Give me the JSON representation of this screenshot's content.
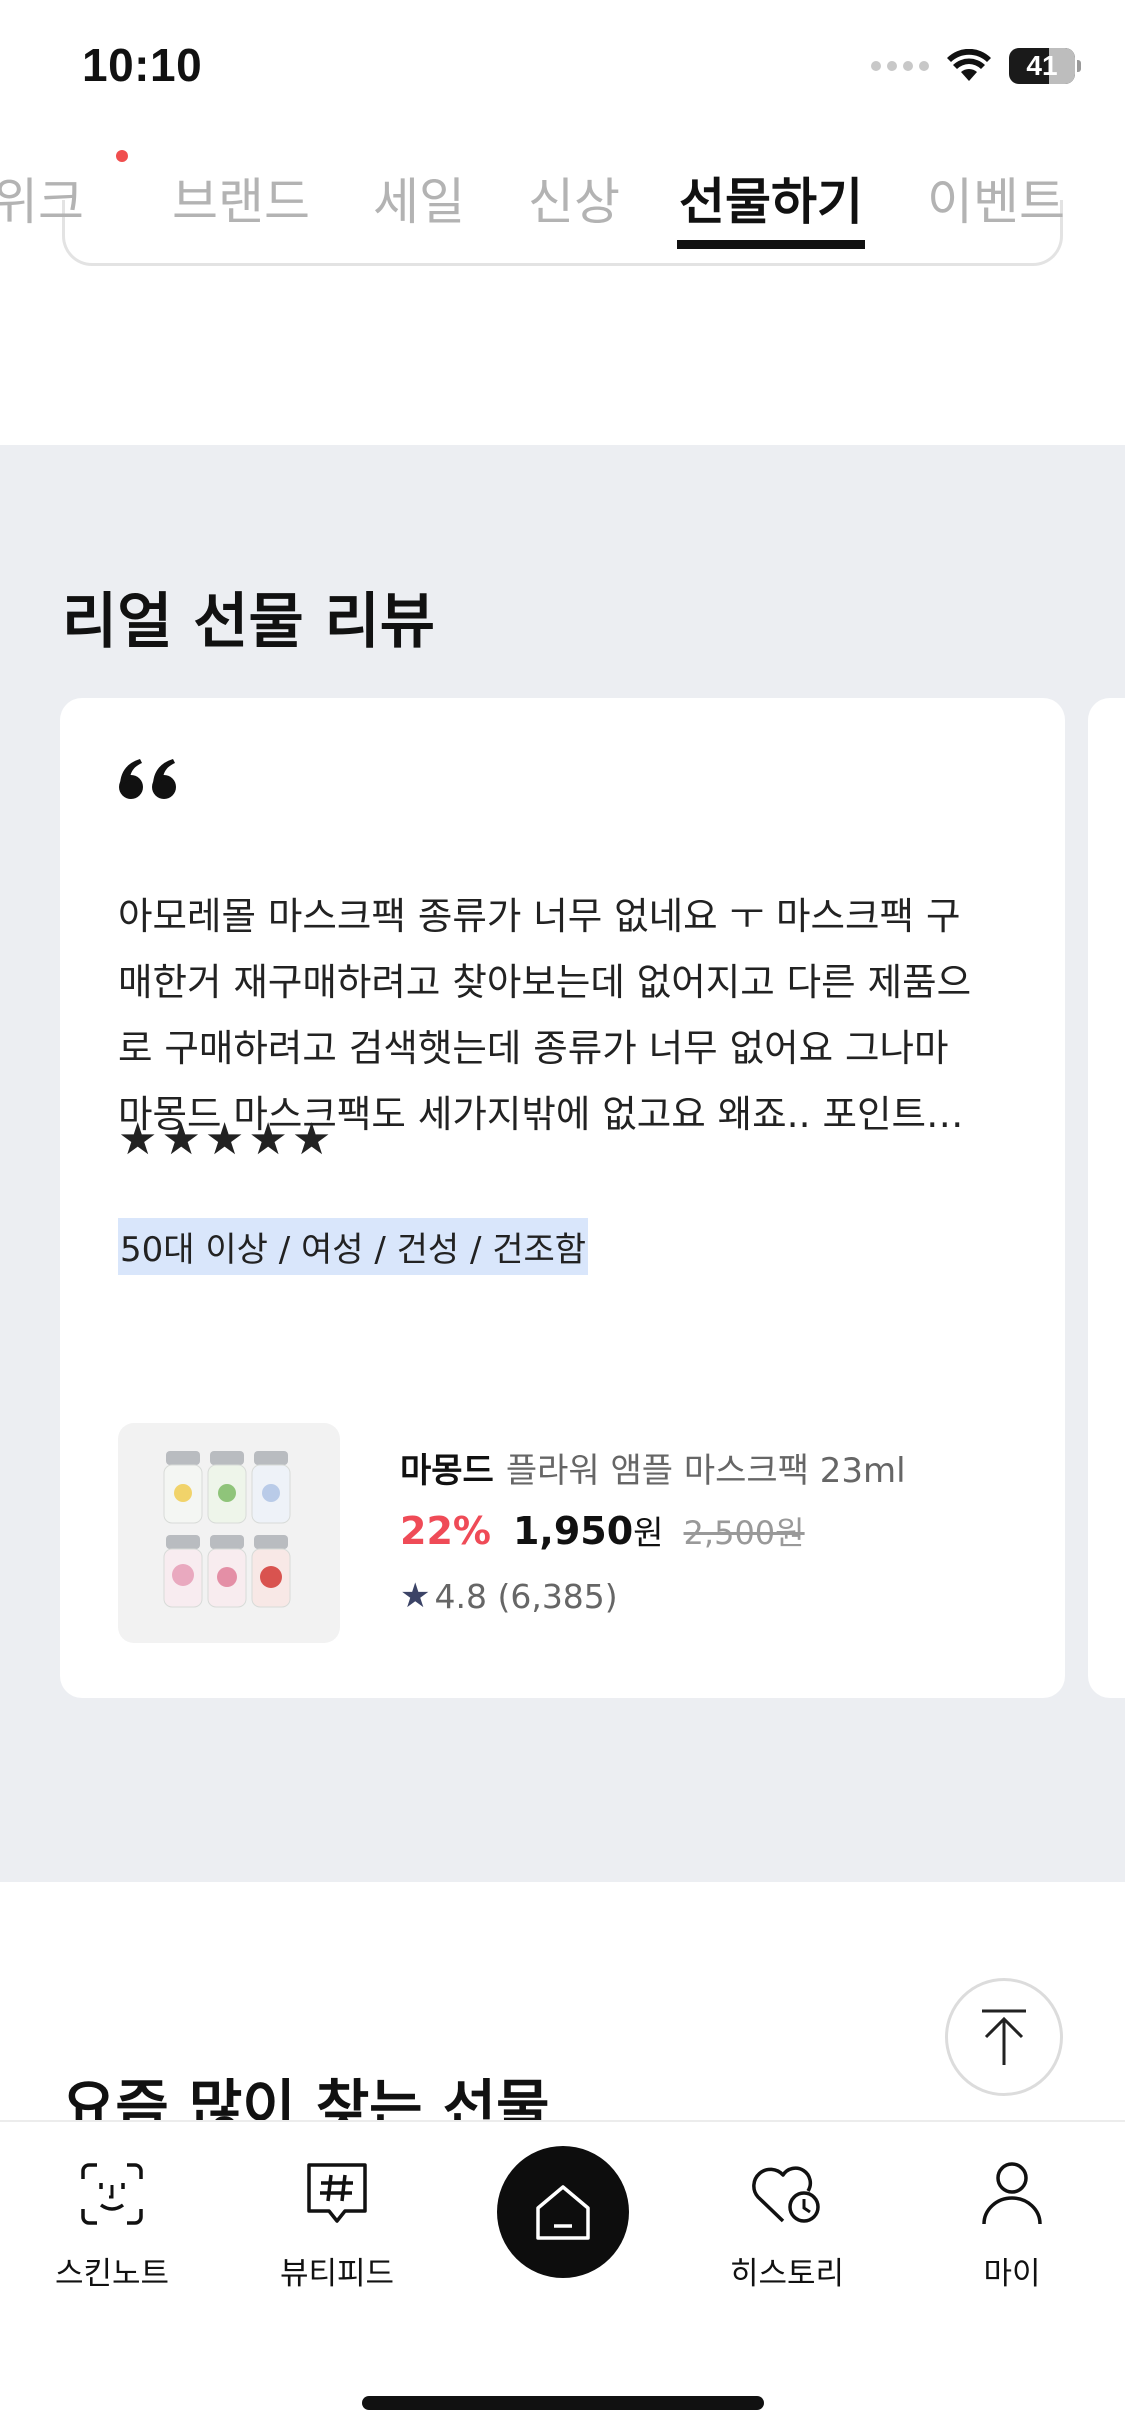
{
  "status_bar": {
    "time": "10:10",
    "battery": "41"
  },
  "tabs": [
    {
      "label": "위크",
      "active": false,
      "has_dot": true
    },
    {
      "label": "브랜드",
      "active": false
    },
    {
      "label": "세일",
      "active": false
    },
    {
      "label": "신상",
      "active": false
    },
    {
      "label": "선물하기",
      "active": true
    },
    {
      "label": "이벤트",
      "active": false
    }
  ],
  "review_section": {
    "title": "리얼 선물 리뷰",
    "review": {
      "text_lines": [
        "아모레몰 마스크팩 종류가 너무 없네요 ㅜ 마스크팩 구",
        "매한거 재구매하려고 찾아보는데 없어지고 다른 제품으",
        "로 구매하려고 검색햇는데 종류가 너무 없어요 그나마",
        "마몽드 마스크팩도 세가지밖에 없고요 왜죠.. 포인트…"
      ],
      "rating_stars": 5,
      "reviewer_tag": "50대 이상 / 여성 / 건성 / 건조함",
      "product": {
        "brand": "마몽드",
        "name": "플라워 앰플 마스크팩 23ml",
        "discount": "22%",
        "price": "1,950",
        "currency": "원",
        "original_price": "2,500원",
        "rating": "4.8 (6,385)"
      }
    }
  },
  "popular_section": {
    "title": "요즘 많이 찾는 선물"
  },
  "bottom_nav": [
    {
      "label": "스킨노트",
      "icon": "face-scan-icon"
    },
    {
      "label": "뷰티피드",
      "icon": "hashtag-chat-icon"
    },
    {
      "label": "",
      "icon": "home-icon"
    },
    {
      "label": "히스토리",
      "icon": "heart-history-icon"
    },
    {
      "label": "마이",
      "icon": "person-icon"
    }
  ]
}
